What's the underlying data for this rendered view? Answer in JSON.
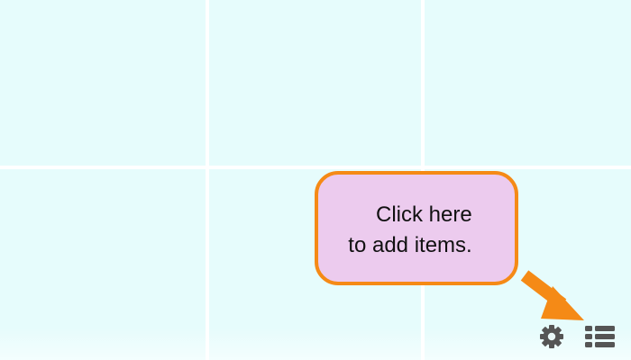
{
  "callout": {
    "line1": "Click here",
    "line2": "to add items."
  },
  "colors": {
    "background": "#e6fcfc",
    "grid_lines": "#ffffff",
    "callout_fill": "#eccbee",
    "callout_border": "#f58a16",
    "arrow": "#f58a16",
    "icons": "#555555"
  },
  "icons": {
    "settings": "gear-icon",
    "items_list": "list-icon",
    "pointer": "arrow-down-right-icon"
  }
}
